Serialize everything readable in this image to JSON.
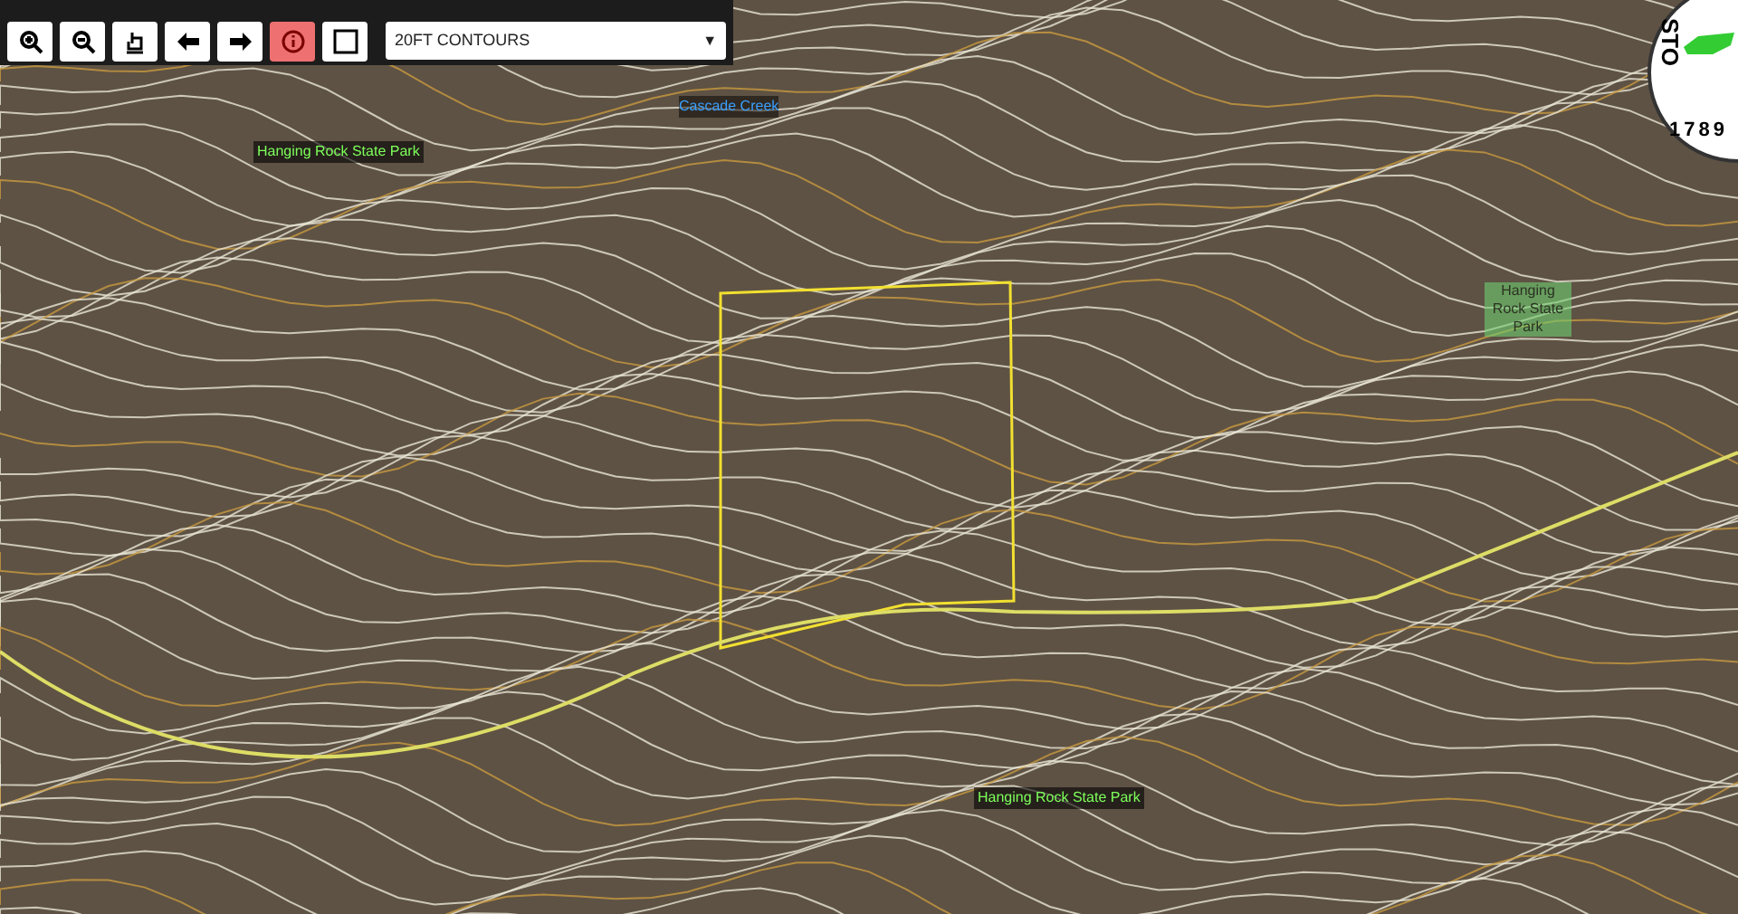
{
  "toolbar": {
    "tools": [
      {
        "kind": "zoom-in",
        "selected": false
      },
      {
        "kind": "zoom-out",
        "selected": false
      },
      {
        "kind": "pan",
        "selected": false
      },
      {
        "kind": "back",
        "selected": false
      },
      {
        "kind": "forward",
        "selected": false
      },
      {
        "kind": "info",
        "selected": true
      },
      {
        "kind": "select-box",
        "selected": false
      }
    ],
    "layer_select": {
      "value": "20FT CONTOURS",
      "caret": "▼"
    }
  },
  "logo": {
    "text": "STO",
    "year": "1789"
  },
  "map": {
    "labels": [
      {
        "kind": "park",
        "text": "Hanging Rock State Park"
      },
      {
        "kind": "water",
        "text": "Cascade Creek"
      },
      {
        "kind": "park",
        "text": "Hanging Rock State Park"
      },
      {
        "kind": "park",
        "text": "Hanging Rock State Park"
      }
    ]
  }
}
